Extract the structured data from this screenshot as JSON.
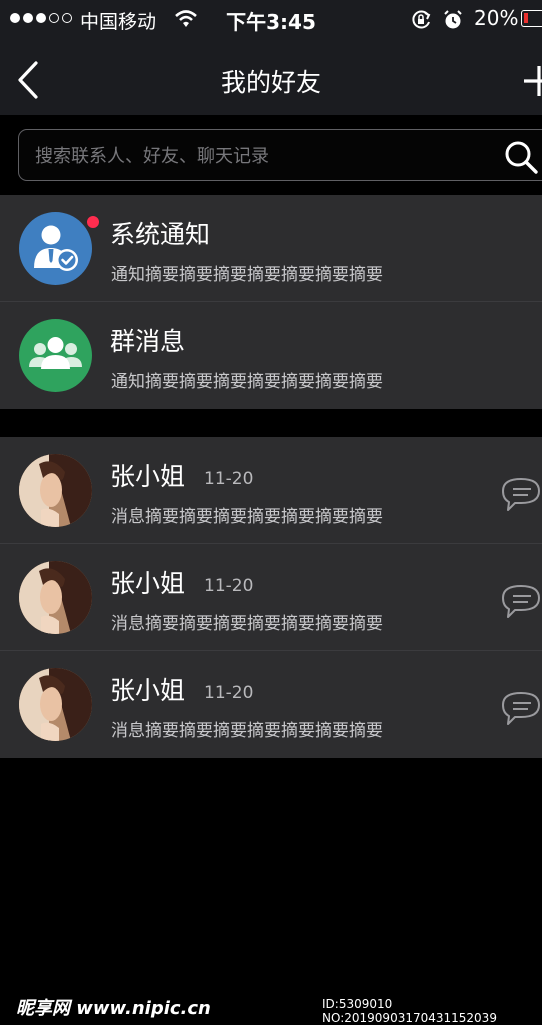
{
  "status_bar": {
    "carrier": "中国移动",
    "time": "下午3:45",
    "battery": "20%",
    "icons": [
      "signal-dots",
      "wifi-icon",
      "rotation-lock-icon",
      "alarm-icon",
      "battery-icon"
    ]
  },
  "nav": {
    "title": "我的好友",
    "back_icon": "back-arrow-icon",
    "add_icon": "plus-icon"
  },
  "search": {
    "placeholder": "搜索联系人、好友、聊天记录",
    "icon": "search-icon"
  },
  "system_items": [
    {
      "title": "系统通知",
      "summary": "通知摘要摘要摘要摘要摘要摘要摘要",
      "icon": "system-notification-icon",
      "unread_dot": true
    },
    {
      "title": "群消息",
      "summary": "通知摘要摘要摘要摘要摘要摘要摘要",
      "icon": "group-icon",
      "unread_dot": false
    }
  ],
  "contacts": [
    {
      "name": "张小姐",
      "date": "11-20",
      "summary": "消息摘要摘要摘要摘要摘要摘要摘要",
      "action_icon": "chat-bubble-icon"
    },
    {
      "name": "张小姐",
      "date": "11-20",
      "summary": "消息摘要摘要摘要摘要摘要摘要摘要",
      "action_icon": "chat-bubble-icon"
    },
    {
      "name": "张小姐",
      "date": "11-20",
      "summary": "消息摘要摘要摘要摘要摘要摘要摘要",
      "action_icon": "chat-bubble-icon"
    }
  ],
  "watermark": {
    "left": "昵享网 www.nipic.cn",
    "right": "ID:5309010 NO:20190903170431152039"
  },
  "colors": {
    "bar_background": "#1b1c20",
    "list_background": "#2d2d2f",
    "page_background": "#000000",
    "badge": "#ff2d4f",
    "system_avatar": "#3f7fc1",
    "group_avatar": "#2fa35e"
  }
}
